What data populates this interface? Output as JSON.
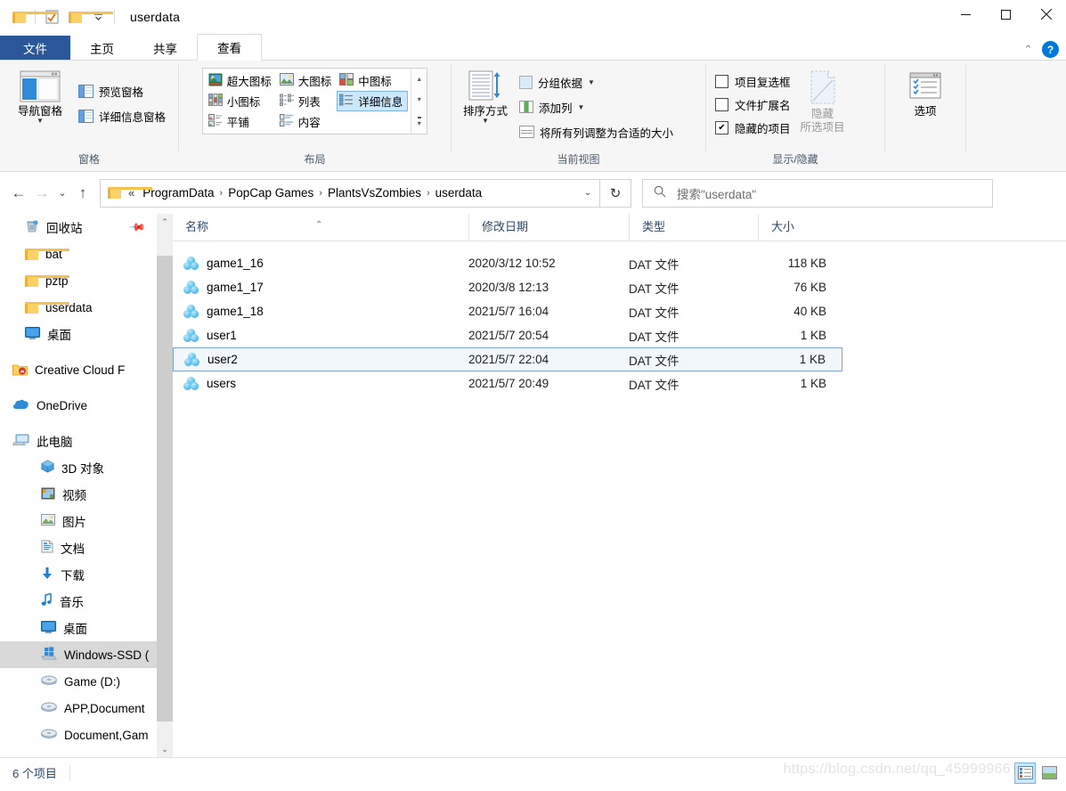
{
  "window": {
    "title": "userdata",
    "quick_access": [
      "folder-icon",
      "checklist-icon",
      "folder-icon",
      "chevron-down-icon"
    ],
    "controls": {
      "minimize": "—",
      "maximize": "☐",
      "close": "✕"
    },
    "ribbon_collapse": "⌃",
    "help": "?"
  },
  "tabs": [
    {
      "label": "文件",
      "name": "tab-file"
    },
    {
      "label": "主页",
      "name": "tab-home"
    },
    {
      "label": "共享",
      "name": "tab-share"
    },
    {
      "label": "查看",
      "name": "tab-view",
      "active": true
    }
  ],
  "ribbon": {
    "groups": [
      {
        "name": "panes",
        "label": "窗格",
        "big_button": {
          "label": "导航窗格",
          "icon": "navigation-pane-icon"
        },
        "items": [
          {
            "label": "预览窗格",
            "icon": "preview-pane-icon"
          },
          {
            "label": "详细信息窗格",
            "icon": "details-pane-icon"
          }
        ]
      },
      {
        "name": "layout",
        "label": "布局",
        "gallery": [
          {
            "label": "超大图标",
            "icon": "extra-large-icons-icon",
            "selected": false
          },
          {
            "label": "大图标",
            "icon": "large-icons-icon",
            "selected": false
          },
          {
            "label": "中图标",
            "icon": "medium-icons-icon",
            "selected": false
          },
          {
            "label": "小图标",
            "icon": "small-icons-icon",
            "selected": false
          },
          {
            "label": "列表",
            "icon": "list-view-icon",
            "selected": false
          },
          {
            "label": "详细信息",
            "icon": "details-view-icon",
            "selected": true
          },
          {
            "label": "平铺",
            "icon": "tiles-view-icon",
            "selected": false
          },
          {
            "label": "内容",
            "icon": "content-view-icon",
            "selected": false
          }
        ],
        "scroll": {
          "up": "▴",
          "down": "▾",
          "more": "▾"
        }
      },
      {
        "name": "current-view",
        "label": "当前视图",
        "big_button": {
          "label": "排序方式",
          "icon": "sort-by-icon"
        },
        "items": [
          {
            "label": "分组依据",
            "icon": "group-by-icon",
            "dropdown": true
          },
          {
            "label": "添加列",
            "icon": "add-columns-icon",
            "dropdown": true
          },
          {
            "label": "将所有列调整为合适的大小",
            "icon": "size-columns-icon",
            "dropdown": false
          }
        ]
      },
      {
        "name": "show-hide",
        "label": "显示/隐藏",
        "checkboxes": [
          {
            "label": "项目复选框",
            "checked": false
          },
          {
            "label": "文件扩展名",
            "checked": false
          },
          {
            "label": "隐藏的项目",
            "checked": true
          }
        ],
        "hide_button": {
          "line1": "隐藏",
          "line2": "所选项目",
          "icon": "hide-selected-items-icon",
          "disabled": true
        }
      },
      {
        "name": "options",
        "label": "",
        "big_button": {
          "label": "选项",
          "icon": "options-icon"
        }
      }
    ]
  },
  "navigation": {
    "back": "←",
    "forward": "→",
    "recent": "⌄",
    "up": "↑",
    "refresh": "↻",
    "address_caret": "⌄",
    "folder_icon": "folder-icon",
    "ellipsis": "«",
    "breadcrumbs": [
      "ProgramData",
      "PopCap Games",
      "PlantsVsZombies",
      "userdata"
    ],
    "separator": "›",
    "search": {
      "placeholder": "搜索\"userdata\"",
      "icon": "search-icon"
    }
  },
  "sidebar": {
    "scroll": {
      "up": "⌃",
      "down": "⌄"
    },
    "items": [
      {
        "label": "回收站",
        "icon": "recycle-bin-icon",
        "level": 1,
        "pinned": true
      },
      {
        "label": "bat",
        "icon": "folder-icon",
        "level": 1
      },
      {
        "label": "pztp",
        "icon": "folder-icon",
        "level": 1
      },
      {
        "label": "userdata",
        "icon": "folder-icon",
        "level": 1
      },
      {
        "label": "桌面",
        "icon": "desktop-icon",
        "level": 1
      },
      {
        "label": "Creative Cloud F",
        "icon": "creative-cloud-folder-icon",
        "level": 0,
        "gap_before": true
      },
      {
        "label": "OneDrive",
        "icon": "onedrive-icon",
        "level": 0,
        "gap_before": true
      },
      {
        "label": "此电脑",
        "icon": "this-pc-icon",
        "level": 0,
        "gap_before": true
      },
      {
        "label": "3D 对象",
        "icon": "3d-objects-icon",
        "level": 1
      },
      {
        "label": "视频",
        "icon": "videos-icon",
        "level": 1
      },
      {
        "label": "图片",
        "icon": "pictures-icon",
        "level": 1
      },
      {
        "label": "文档",
        "icon": "documents-icon",
        "level": 1
      },
      {
        "label": "下载",
        "icon": "downloads-icon",
        "level": 1
      },
      {
        "label": "音乐",
        "icon": "music-icon",
        "level": 1
      },
      {
        "label": "桌面",
        "icon": "desktop-icon",
        "level": 1
      },
      {
        "label": "Windows-SSD (",
        "icon": "windows-drive-icon",
        "level": 1,
        "selected": true
      },
      {
        "label": "Game (D:)",
        "icon": "drive-icon",
        "level": 1
      },
      {
        "label": "APP,Document",
        "icon": "drive-icon",
        "level": 1
      },
      {
        "label": "Document,Gam",
        "icon": "drive-icon",
        "level": 1
      }
    ]
  },
  "filelist": {
    "columns": [
      {
        "label": "名称",
        "key": "name",
        "sorted": "asc",
        "sort_caret": "⌃"
      },
      {
        "label": "修改日期",
        "key": "date"
      },
      {
        "label": "类型",
        "key": "type"
      },
      {
        "label": "大小",
        "key": "size"
      }
    ],
    "rows": [
      {
        "name": "game1_16",
        "date": "2020/3/12 10:52",
        "type": "DAT 文件",
        "size": "118 KB",
        "icon": "dat-file-icon",
        "selected": false
      },
      {
        "name": "game1_17",
        "date": "2020/3/8 12:13",
        "type": "DAT 文件",
        "size": "76 KB",
        "icon": "dat-file-icon",
        "selected": false
      },
      {
        "name": "game1_18",
        "date": "2021/5/7 16:04",
        "type": "DAT 文件",
        "size": "40 KB",
        "icon": "dat-file-icon",
        "selected": false
      },
      {
        "name": "user1",
        "date": "2021/5/7 20:54",
        "type": "DAT 文件",
        "size": "1 KB",
        "icon": "dat-file-icon",
        "selected": false
      },
      {
        "name": "user2",
        "date": "2021/5/7 22:04",
        "type": "DAT 文件",
        "size": "1 KB",
        "icon": "dat-file-icon",
        "selected": true
      },
      {
        "name": "users",
        "date": "2021/5/7 20:49",
        "type": "DAT 文件",
        "size": "1 KB",
        "icon": "dat-file-icon",
        "selected": false
      }
    ]
  },
  "status": {
    "count": "6 个项目",
    "watermark": "https://blog.csdn.net/qq_45999966",
    "view_buttons": [
      {
        "name": "details-view-button",
        "active": true
      },
      {
        "name": "thumbnail-view-button",
        "active": false
      }
    ]
  },
  "colors": {
    "accent": "#0078d7",
    "file_tab": "#2b579a",
    "selection_border": "#7da2ce",
    "selection_fill": "#f2f7fb",
    "ribbon_bg": "#f6f6f6",
    "nav_selected": "#d8d8d8"
  }
}
